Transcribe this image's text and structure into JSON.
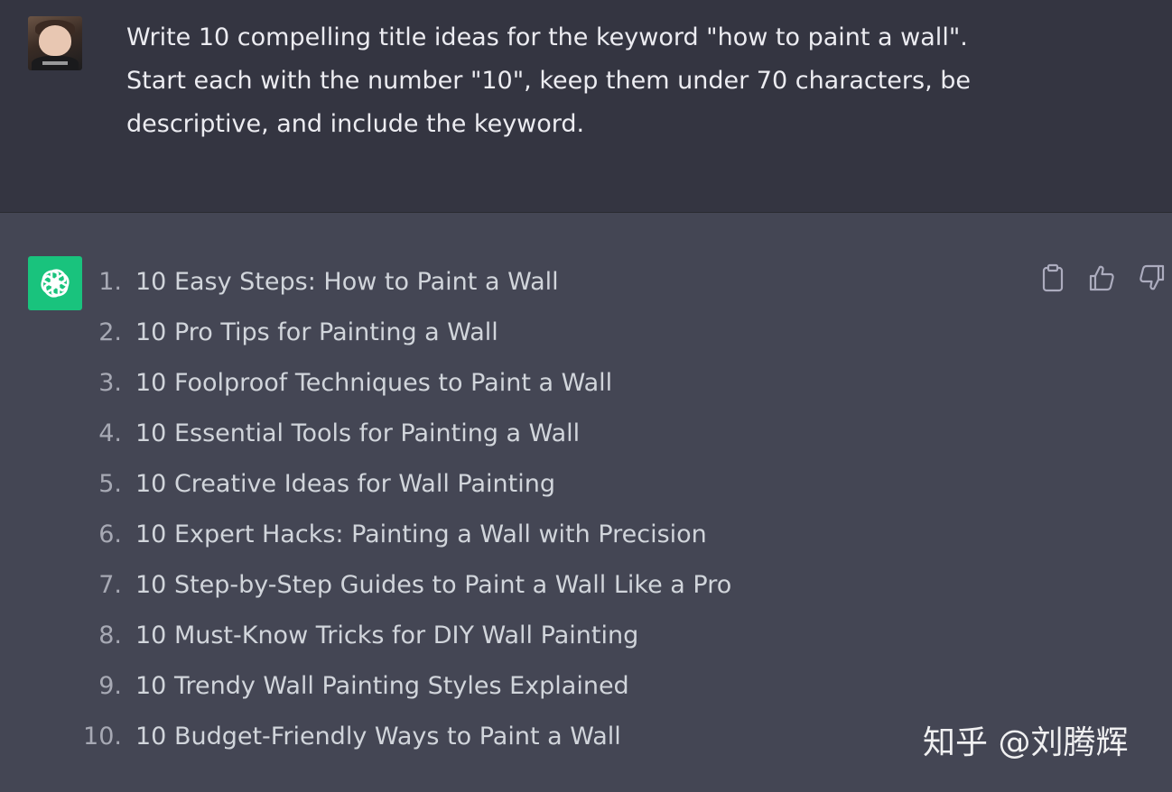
{
  "user_message": {
    "avatar_icon": "user-avatar-photo",
    "text": "Write 10 compelling title ideas for the keyword \"how to paint a wall\".\nStart each with the number \"10\",  keep them under 70 characters, be\ndescriptive, and include the keyword."
  },
  "assistant_message": {
    "avatar_icon": "openai-logo-icon",
    "avatar_color": "#19c37d",
    "items": [
      {
        "num": "1.",
        "text": "10 Easy Steps: How to Paint a Wall"
      },
      {
        "num": "2.",
        "text": "10 Pro Tips for Painting a Wall"
      },
      {
        "num": "3.",
        "text": "10 Foolproof Techniques to Paint a Wall"
      },
      {
        "num": "4.",
        "text": "10 Essential Tools for Painting a Wall"
      },
      {
        "num": "5.",
        "text": "10 Creative Ideas for Wall Painting"
      },
      {
        "num": "6.",
        "text": "10 Expert Hacks: Painting a Wall with Precision"
      },
      {
        "num": "7.",
        "text": "10 Step-by-Step Guides to Paint a Wall Like a Pro"
      },
      {
        "num": "8.",
        "text": "10 Must-Know Tricks for DIY Wall Painting"
      },
      {
        "num": "9.",
        "text": "10 Trendy Wall Painting Styles Explained"
      },
      {
        "num": "10.",
        "text": "10 Budget-Friendly Ways to Paint a Wall"
      }
    ]
  },
  "actions": {
    "icons": [
      "clipboard-icon",
      "thumbs-up-icon",
      "thumbs-down-icon"
    ]
  },
  "watermark": {
    "text": "知乎 @刘腾辉"
  },
  "colors": {
    "user_bg": "#343541",
    "assistant_bg": "#444654",
    "accent": "#19c37d"
  }
}
